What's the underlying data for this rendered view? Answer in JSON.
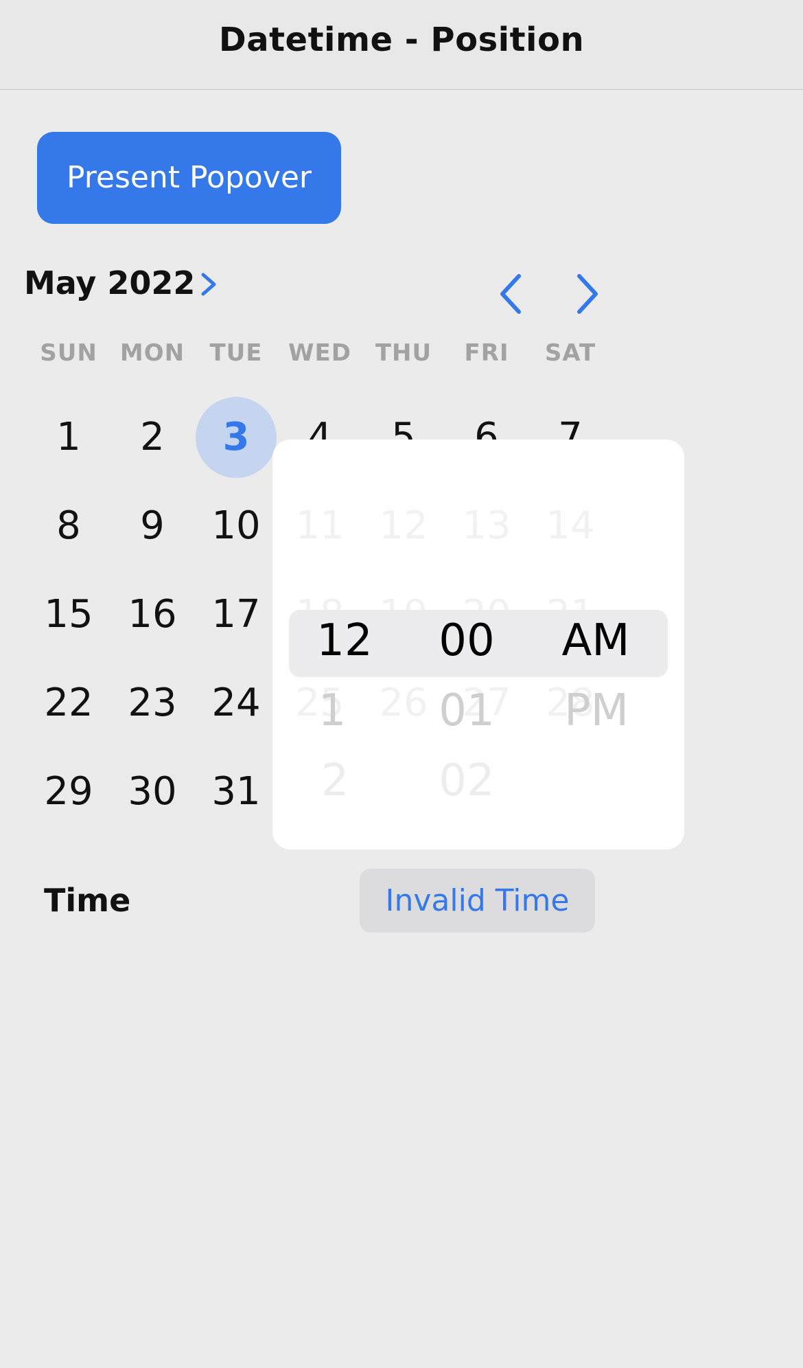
{
  "nav": {
    "title": "Datetime - Position"
  },
  "present_button": {
    "label": "Present Popover"
  },
  "calendar": {
    "month_label": "May 2022",
    "weekdays": [
      "SUN",
      "MON",
      "TUE",
      "WED",
      "THU",
      "FRI",
      "SAT"
    ],
    "selected_day": "3",
    "days": {
      "d1": "1",
      "d2": "2",
      "d3": "3",
      "d4": "4",
      "d5": "5",
      "d6": "6",
      "d7": "7",
      "d8": "8",
      "d9": "9",
      "d10": "10",
      "d15": "15",
      "d16": "16",
      "d17": "17",
      "d22": "22",
      "d23": "23",
      "d24": "24",
      "d29": "29",
      "d30": "30",
      "d31": "31"
    },
    "hidden_days": {
      "row2": [
        "11",
        "12",
        "13",
        "14"
      ],
      "row3": [
        "18",
        "19",
        "20",
        "21"
      ],
      "row4": [
        "25",
        "26",
        "27",
        "28"
      ]
    }
  },
  "time_row": {
    "label": "Time",
    "value_button": "Invalid Time"
  },
  "picker": {
    "hours": {
      "selected": "12",
      "next1": "1",
      "next2": "2"
    },
    "minutes": {
      "selected": "00",
      "next1": "01",
      "next2": "02"
    },
    "period": {
      "selected": "AM",
      "next1": "PM"
    }
  },
  "colors": {
    "accent": "#3478ea",
    "selected_day_bg": "#c5d5ef",
    "background": "#ebebeb"
  },
  "icons": {
    "month_chevron": "chevron-right-icon",
    "prev": "chevron-left-icon",
    "next": "chevron-right-icon"
  }
}
